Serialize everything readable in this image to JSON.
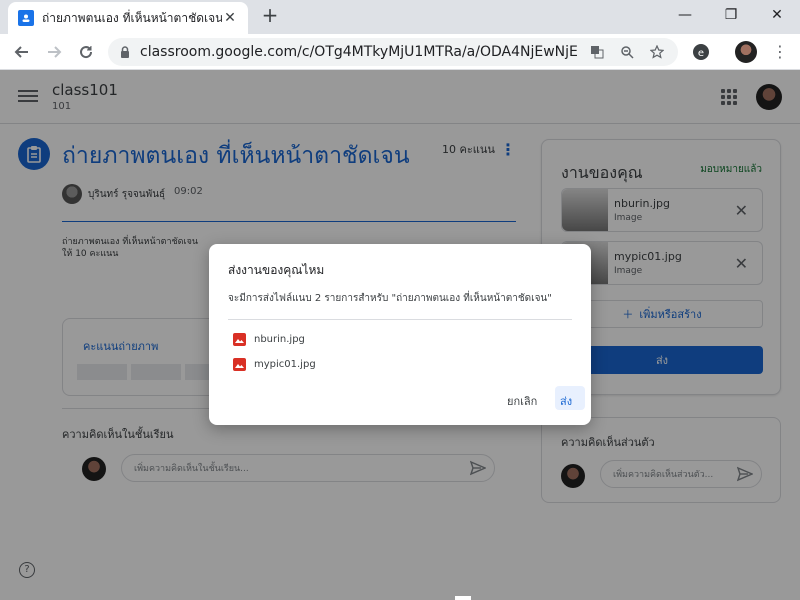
{
  "browser": {
    "tab_title": "ถ่ายภาพตนเอง ที่เห็นหน้าตาชัดเจน",
    "tab_close": "✕",
    "new_tab": "+",
    "url": "classroom.google.com/c/OTg4MTkyMjU1MTRa/a/ODA4NjEwNjE4Nz...",
    "minimize": "—",
    "maximize": "❐",
    "close_window": "✕"
  },
  "appbar": {
    "class_name": "class101",
    "class_section": "101"
  },
  "assignment": {
    "title": "ถ่ายภาพตนเอง ที่เห็นหน้าตาชัดเจน",
    "points": "10 คะแนน",
    "author": "บุรินทร์ รุจจนพันธุ์",
    "time": "09:02",
    "description_line1": "ถ่ายภาพตนเอง ที่เห็นหน้าตาชัดเจน",
    "description_line2": "ให้ 10 คะแนน",
    "rubric_title": "คะแนนถ่ายภาพ",
    "class_comments_label": "ความคิดเห็นในชั้นเรียน",
    "class_comment_placeholder": "เพิ่มความคิดเห็นในชั้นเรียน..."
  },
  "your_work": {
    "title": "งานของคุณ",
    "status": "มอบหมายแล้ว",
    "files": [
      {
        "name": "nburin.jpg",
        "type": "Image"
      },
      {
        "name": "mypic01.jpg",
        "type": "Image"
      }
    ],
    "add_create": "เพิ่มหรือสร้าง",
    "submit": "ส่ง"
  },
  "private_comments": {
    "label": "ความคิดเห็นส่วนตัว",
    "placeholder": "เพิ่มความคิดเห็นส่วนตัว..."
  },
  "dialog": {
    "title": "ส่งงานของคุณไหม",
    "body": "จะมีการส่งไฟล์แนบ 2 รายการสำหรับ \"ถ่ายภาพตนเอง ที่เห็นหน้าตาชัดเจน\"",
    "files": [
      "nburin.jpg",
      "mypic01.jpg"
    ],
    "cancel": "ยกเลิก",
    "submit": "ส่ง"
  },
  "help": "?",
  "colors": {
    "accent": "#1967d2",
    "assigned_status": "#137333",
    "image_icon": "#d93025"
  }
}
